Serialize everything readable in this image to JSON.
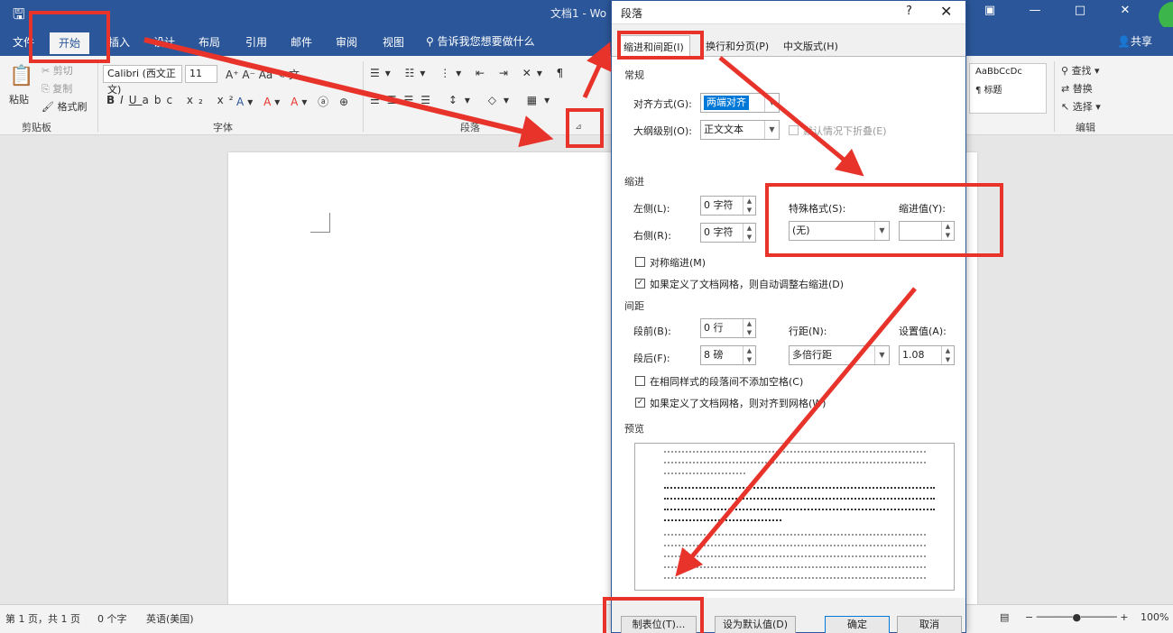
{
  "titlebar": {
    "save_icon": "save-icon",
    "doc_title": "文档1 - Wo",
    "min": "—",
    "max": "□",
    "close": "✕"
  },
  "tabs": [
    "文件",
    "开始",
    "插入",
    "设计",
    "布局",
    "引用",
    "邮件",
    "审阅",
    "视图"
  ],
  "tellme": "告诉我您想要做什么",
  "share": "共享",
  "ribbon": {
    "paste": "粘贴",
    "cut": "剪切",
    "copy": "复制",
    "format_painter": "格式刷",
    "font_name": "Calibri (西文正文)",
    "font_size": "11",
    "clipboard_label": "剪贴板",
    "font_label": "字体",
    "paragraph_label": "段落",
    "styles_preview": "AaBbCcDc",
    "styles_name": "¶ 标题",
    "find": "查找",
    "replace": "替换",
    "select": "选择",
    "editing_label": "编辑"
  },
  "dialog": {
    "title": "段落",
    "help": "?",
    "close": "✕",
    "tabs": [
      "缩进和间距(I)",
      "换行和分页(P)",
      "中文版式(H)"
    ],
    "general_title": "常规",
    "alignment_label": "对齐方式(G):",
    "alignment_value": "两端对齐",
    "outline_label": "大纲级别(O):",
    "outline_value": "正文文本",
    "collapse_label": "默认情况下折叠(E)",
    "indent_title": "缩进",
    "left_label": "左侧(L):",
    "left_value": "0 字符",
    "right_label": "右侧(R):",
    "right_value": "0 字符",
    "special_label": "特殊格式(S):",
    "special_value": "(无)",
    "by_label": "缩进值(Y):",
    "by_value": "",
    "mirror_label": "对称缩进(M)",
    "auto_adjust_label": "如果定义了文档网格，则自动调整右缩进(D)",
    "spacing_title": "间距",
    "before_label": "段前(B):",
    "before_value": "0 行",
    "after_label": "段后(F):",
    "after_value": "8 磅",
    "line_label": "行距(N):",
    "line_value": "多倍行距",
    "at_label": "设置值(A):",
    "at_value": "1.08",
    "no_space_label": "在相同样式的段落间不添加空格(C)",
    "snap_label": "如果定义了文档网格，则对齐到网格(W)",
    "preview_title": "预览",
    "tabs_button": "制表位(T)...",
    "default_button": "设为默认值(D)",
    "ok_button": "确定",
    "cancel_button": "取消"
  },
  "statusbar": {
    "page": "第 1 页，共 1 页",
    "words": "0 个字",
    "lang": "英语(美国)",
    "zoom": "100%"
  },
  "colors": {
    "brand": "#2b579a",
    "annotation": "#e8332b",
    "selection": "#0078d7"
  }
}
